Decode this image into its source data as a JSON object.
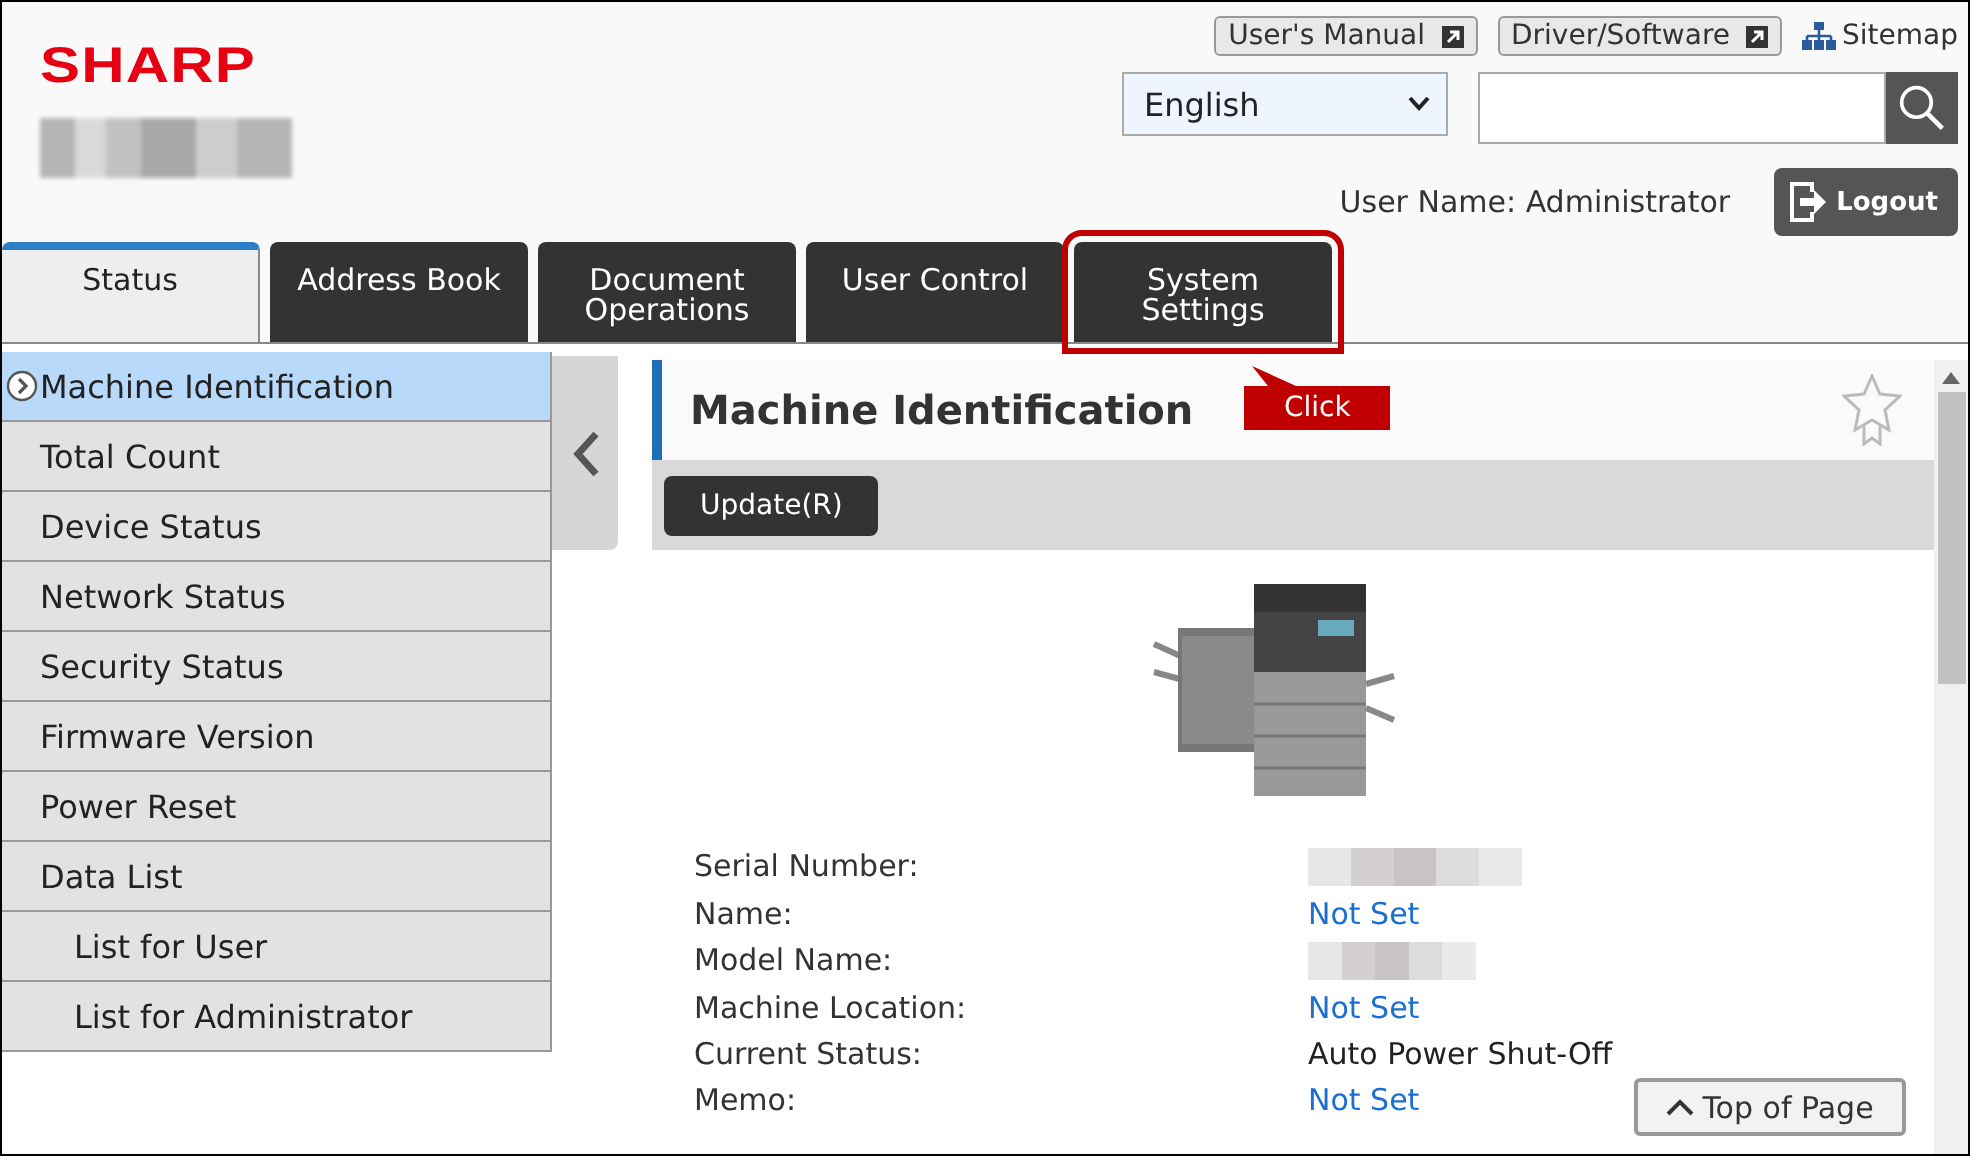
{
  "header": {
    "logo": "SHARP",
    "links": [
      {
        "label": "User's Manual",
        "kind": "external"
      },
      {
        "label": "Driver/Software",
        "kind": "external"
      },
      {
        "label": "Sitemap",
        "kind": "sitemap"
      }
    ],
    "language": "English",
    "user_name": "User Name: Administrator",
    "logout": "Logout"
  },
  "tabs": [
    {
      "label": "Status",
      "selected": true,
      "highlighted": false
    },
    {
      "label": "Address Book",
      "selected": false,
      "highlighted": false
    },
    {
      "label": "Document Operations",
      "selected": false,
      "highlighted": false
    },
    {
      "label": "User Control",
      "selected": false,
      "highlighted": false
    },
    {
      "label": "System Settings",
      "selected": false,
      "highlighted": true
    }
  ],
  "annotation": {
    "text": "Click"
  },
  "sidebar": {
    "items": [
      {
        "label": "Machine Identification",
        "selected": true
      },
      {
        "label": "Total Count",
        "selected": false
      },
      {
        "label": "Device Status",
        "selected": false
      },
      {
        "label": "Network Status",
        "selected": false
      },
      {
        "label": "Security Status",
        "selected": false
      },
      {
        "label": "Firmware Version",
        "selected": false
      },
      {
        "label": "Power Reset",
        "selected": false
      },
      {
        "label": "Data List",
        "selected": false,
        "children": [
          {
            "label": "List for User",
            "selected": false
          },
          {
            "label": "List for Administrator",
            "selected": false
          }
        ]
      }
    ]
  },
  "main": {
    "title": "Machine Identification",
    "update_button": "Update(R)",
    "fields": [
      {
        "label": "Serial Number:",
        "kind": "redacted"
      },
      {
        "label": "Name:",
        "kind": "link",
        "value": "Not Set"
      },
      {
        "label": "Model Name:",
        "kind": "redacted"
      },
      {
        "label": "Machine Location:",
        "kind": "link",
        "value": "Not Set"
      },
      {
        "label": "Current Status:",
        "kind": "text",
        "value": "Auto Power Shut-Off"
      },
      {
        "label": "Memo:",
        "kind": "link",
        "value": "Not Set"
      }
    ],
    "top_button": "Top of Page"
  }
}
